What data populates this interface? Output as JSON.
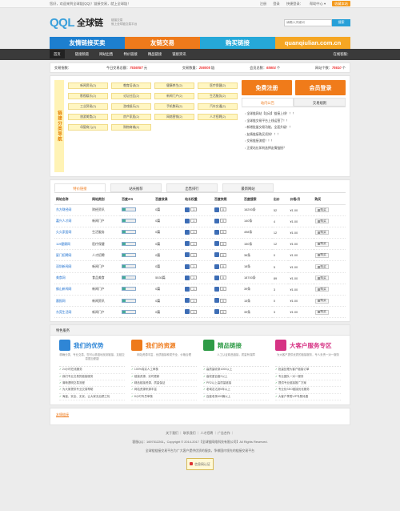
{
  "topbar": {
    "welcome": "您好，欢迎来到全球链(QQ)！链接交易，就上全球链！",
    "register": "注册",
    "login": "登录",
    "quick_login": "快捷登录：",
    "help": "帮助中心 ▾",
    "favorite": "收藏本站"
  },
  "header": {
    "logo_q": "QQL",
    "logo_text": "全球链",
    "slogan1": "链接交易",
    "slogan2": "就上全球链交易平台",
    "search_placeholder": "请输入关键词",
    "search_button": "搜索"
  },
  "banner": {
    "b1": "友情链接买卖",
    "b2": "友链交易",
    "b3": "购买链接",
    "b4": "quanqiulian.com.cn"
  },
  "nav": {
    "items": [
      "首页",
      "链接频道",
      "网站出售",
      "特价链接",
      "精品链接",
      "链接资讯"
    ],
    "right": "在线客服："
  },
  "stats": {
    "l1": "交易指数：",
    "l2": "今日交易总额：",
    "v2": "7636057",
    "u2": "元",
    "l3": "交易数量：",
    "v3": "256005",
    "u3": "链",
    "l4": "会员总数：",
    "v4": "65604",
    "u4": "个",
    "l5": "网站个数：",
    "v5": "75610",
    "u5": "个"
  },
  "categories": {
    "vertical_label": "链接分类导航",
    "items": [
      "新闻资讯(2)",
      "教育培训(2)",
      "健康养生(2)",
      "医疗保健(2)",
      "影视娱乐(2)",
      "论坛社区(2)",
      "新闻门户(2)",
      "生活服务(2)",
      "工业贸易(2)",
      "游戏娱乐(2)",
      "手机数码(2)",
      "汽车交通(2)",
      "旅游美食(2)",
      "房产家居(2)",
      "网络营销(2)",
      "人才招聘(2)",
      "母婴育儿(2)",
      "购物商城(2)"
    ]
  },
  "side": {
    "btn_free": "免费注册",
    "btn_member": "会员登录",
    "tab1": "站内公告",
    "tab2": "交易规则",
    "news": [
      "全球链网站【自动】链接上线！！！",
      "全球链交易平台上线运营了！！",
      "新增批量交易功能，全面升级！！",
      "友情链接购买须知！！！",
      "交易链接流程！！！",
      "正规站长如何选择友情链接？"
    ]
  },
  "listing": {
    "tabs": [
      "特价链接",
      "站长推荐",
      "出售排行",
      "最新网站"
    ],
    "headers": [
      "网站名称",
      "网站类别",
      "百度/PR",
      "百度收录",
      "站长权重",
      "百度快照",
      "百度搜索",
      "出价",
      "价格/月",
      "购买"
    ],
    "rows": [
      [
        "东方财经网",
        "财经资讯",
        "2",
        "0篇",
        "1",
        "0",
        "16200条",
        "52",
        "¥1.00",
        "购买"
      ],
      [
        "嘉兴人才网",
        "新闻门户",
        "1",
        "0篇",
        "1",
        "0",
        "140条",
        "4",
        "¥1.00",
        "购买"
      ],
      [
        "久久家居网",
        "生活服务",
        "1",
        "0篇",
        "1",
        "0",
        "498条",
        "12",
        "¥1.00",
        "购买"
      ],
      [
        "119健康网",
        "医疗保健",
        "1",
        "0篇",
        "1",
        "0",
        "150条",
        "12",
        "¥1.00",
        "购买"
      ],
      [
        "厦门招聘网",
        "人才招聘",
        "1",
        "0篇",
        "1",
        "0",
        "36条",
        "0",
        "¥1.00",
        "购买"
      ],
      [
        "深圳新闻网",
        "新闻门户",
        "1",
        "0篇",
        "1",
        "0",
        "18条",
        "5",
        "¥1.00",
        "购买"
      ],
      [
        "美食网",
        "食品美食",
        "1",
        "5530篇",
        "1",
        "0",
        "18700条",
        "89",
        "¥1.00",
        "购买"
      ],
      [
        "佛山新闻网",
        "新闻门户",
        "1",
        "0篇",
        "1",
        "0",
        "39条",
        "3",
        "¥1.00",
        "购买"
      ],
      [
        "晨报网",
        "新闻资讯",
        "1",
        "0篇",
        "1",
        "0",
        "15条",
        "0",
        "¥1.00",
        "购买"
      ],
      [
        "东莞生活网",
        "新闻门户",
        "1",
        "0篇",
        "1",
        "0",
        "39条",
        "3",
        "¥1.00",
        "购买"
      ]
    ]
  },
  "features": {
    "title": "特色服务",
    "items": [
      {
        "title": "我们的优势",
        "color": "#2f86d6",
        "desc": "精确分类，专业交易，您可以精准地找到链接，友链交易更加便捷",
        "list": [
          "24小时在线服务",
          "我们专业交易的链接服务",
          "清晰透明交易流程",
          "为大家提供专业交易帮助",
          "海量、安全、无忧，让大家无后顾之忧"
        ]
      },
      {
        "title": "我们的资源",
        "color": "#ee7a1b",
        "desc": "网站资源丰富，优质链接种类齐全，价格合理",
        "list": [
          "100%真实人工审核",
          "链接资源，实时更新",
          "精品链接资源，质量保证",
          "网站资源来源丰富",
          "8小时专员审核"
        ]
      },
      {
        "title": "精品链接",
        "color": "#2e9b46",
        "desc": "人工认证精品链接，质量有保障",
        "list": [
          "高质量收录1000以上",
          "高权重百度2以上",
          "PR2以上高质量链接",
          "老域名达到5年以上",
          "百度收录600篇以上"
        ]
      },
      {
        "title": "大客户服务专区",
        "color": "#d63384",
        "desc": "为大客户提供优质的链接服务，专人负责一对一服务",
        "list": [
          "批量处理大客户链接订单",
          "专业团队一对一服务",
          "提供专业链接推广方案",
          "专业化SEO链接优化服务",
          "大客户享受VIP专属待遇"
        ]
      }
    ]
  },
  "links": {
    "title": "友情链接"
  },
  "footer": {
    "nav": "关于我们 ｜ 联系我们 ｜ 人才招聘 ｜ 广告合作 ｜",
    "copyright": "客服QQ：1697512261，Copyright © 2014-2017【全球链网络科技有限公司】All Rights Reserved.",
    "note": "全球链链接交易平台为广大客户提供优质的服务，争做国内领先的链接交易平台",
    "badge": "信息网认证"
  },
  "colors": {
    "orange": "#ee7a1b",
    "blue": "#1d7fcf",
    "dark_nav": "#3a3a3a"
  }
}
